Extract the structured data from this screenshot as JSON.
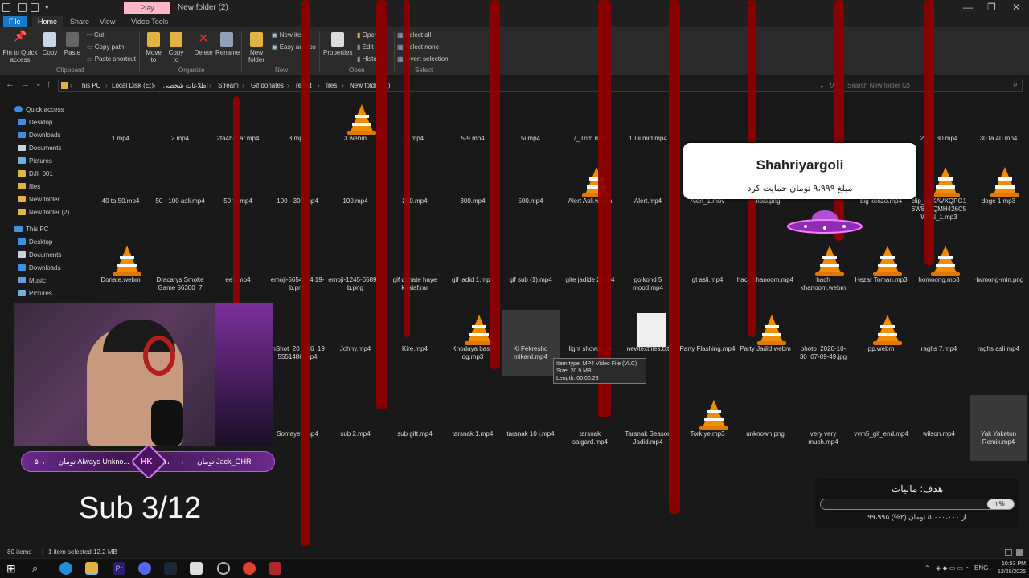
{
  "window": {
    "context_tab": "Play",
    "title": "New folder (2)",
    "minimize_glyph": "—",
    "maximize_glyph": "❐",
    "close_glyph": "✕"
  },
  "tabs": [
    "File",
    "Home",
    "Share",
    "View",
    "Video Tools"
  ],
  "ribbon": {
    "clipboard": {
      "pin_label": "Pin to Quick access",
      "copy_label": "Copy",
      "paste_label": "Paste",
      "cut_label": "Cut",
      "copy_path_label": "Copy path",
      "paste_shortcut_label": "Paste shortcut",
      "group_label": "Clipboard"
    },
    "organize": {
      "move_to_label": "Move to",
      "copy_to_label": "Copy to",
      "delete_label": "Delete",
      "rename_label": "Rename",
      "group_label": "Organize"
    },
    "new": {
      "new_folder_label": "New folder",
      "new_item_label": "New item",
      "easy_access_label": "Easy access",
      "group_label": "New"
    },
    "open": {
      "properties_label": "Properties",
      "open_label": "Open",
      "edit_label": "Edit",
      "history_label": "History",
      "group_label": "Open"
    },
    "select": {
      "select_all_label": "Select all",
      "select_none_label": "Select none",
      "invert_label": "Invert selection",
      "group_label": "Select"
    }
  },
  "address": {
    "back": "←",
    "forward": "→",
    "recent": "⌄",
    "up": "↑",
    "crumbs": [
      "This PC",
      "Local Disk (E:)",
      "اطلاعات شخصی",
      "Stream",
      "Gif donates",
      "reject",
      "files",
      "New folder (2)"
    ],
    "search_placeholder": "Search New folder (2)"
  },
  "sidebar": {
    "quick_access_label": "Quick access",
    "quick_items": [
      "Desktop",
      "Downloads",
      "Documents",
      "Pictures",
      "DJI_001",
      "files",
      "New folder",
      "New folder (2)"
    ],
    "this_pc_label": "This PC",
    "pc_items": [
      "Desktop",
      "Documents",
      "Downloads",
      "Music",
      "Pictures"
    ]
  },
  "files": [
    {
      "name": "1.mp4"
    },
    {
      "name": "2.mp4"
    },
    {
      "name": "2ta4hezar.mp4"
    },
    {
      "name": "3.mp4"
    },
    {
      "name": "3.webm"
    },
    {
      "name": "4.mp4"
    },
    {
      "name": "5-9.mp4"
    },
    {
      "name": "5i.mp4"
    },
    {
      "name": "7_Trim.mp4"
    },
    {
      "name": "10 ii mid.mp4"
    },
    {
      "name": "20 ta 30.mp4"
    },
    {
      "name": "30 ta 40.mp4"
    },
    {
      "name": "40 ta 50.mp4"
    },
    {
      "name": "50 - 100 asli.mp4"
    },
    {
      "name": "50 ta.mp4"
    },
    {
      "name": "100 - 300.mp4"
    },
    {
      "name": "100.mp4"
    },
    {
      "name": "200.mp4"
    },
    {
      "name": "300.mp4"
    },
    {
      "name": "500.mp4"
    },
    {
      "name": "Alert Asli.webm"
    },
    {
      "name": "Alert.mp4"
    },
    {
      "name": "Alert_1.mov"
    },
    {
      "name": "ambki.png"
    },
    {
      "name": "big kenzo.mp4"
    },
    {
      "name": "clip_01KAVXQPG16W8A2QMH426C5WYN_1.mp3"
    },
    {
      "name": "doge 1.mp3"
    },
    {
      "name": "Donate.webm"
    },
    {
      "name": "Dracarys Smoke Game 56300_7"
    },
    {
      "name": "eeh.mp4"
    },
    {
      "name": "emoji-5654254 19-b.png"
    },
    {
      "name": "emoji-1245-65891-b.png"
    },
    {
      "name": "gif donate haye khalaf.rar"
    },
    {
      "name": "gif jadid 1.mp4"
    },
    {
      "name": "gif sub (1).mp4"
    },
    {
      "name": "gife jadide 2.mp4"
    },
    {
      "name": "golkond 5 mood.mp4"
    },
    {
      "name": "gt asli.mp4"
    },
    {
      "name": "hach khanoom.mp4"
    },
    {
      "name": "hach khanoom.webm"
    },
    {
      "name": "Hezar Toman.mp3"
    },
    {
      "name": "homoong.mp3"
    },
    {
      "name": "Hwmong-min.png"
    },
    {
      "name": "InShot_20_706_195551486.mp4"
    },
    {
      "name": "Johny.mp4"
    },
    {
      "name": "Kire.mp4"
    },
    {
      "name": "Khodaya base dg.mp3"
    },
    {
      "name": "Ki Fekresho mikard.mp4"
    },
    {
      "name": "light show.mp4"
    },
    {
      "name": "newtextfiles.txt"
    },
    {
      "name": "Party Flashing.mp4"
    },
    {
      "name": "Party Jadid.webm"
    },
    {
      "name": "photo_2020-10-30_07-09-49.jpg"
    },
    {
      "name": "pp.webm"
    },
    {
      "name": "raghs 7.mp4"
    },
    {
      "name": "raghs asli.mp4"
    },
    {
      "name": "Somayeh.mp4"
    },
    {
      "name": "sub 2.mp4"
    },
    {
      "name": "sub gift.mp4"
    },
    {
      "name": "tarsnak 1.mp4"
    },
    {
      "name": "tarsnak 10 i.mp4"
    },
    {
      "name": "tarsnak salgard.mp4"
    },
    {
      "name": "Tarsnak Season Jadid.mp4"
    },
    {
      "name": "Torkiye.mp3"
    },
    {
      "name": "unknown.png"
    },
    {
      "name": "very very much.mp4"
    },
    {
      "name": "vvm5_gif_end.mp4"
    },
    {
      "name": "wilson.mp4"
    },
    {
      "name": "Yak Yaketon Remix.mp4"
    }
  ],
  "tooltip": {
    "type": "Item type: MP4 Video File (VLC)",
    "size": "Size: 20.9 MB",
    "length": "Length: 00:00:23"
  },
  "overlay": {
    "alert_name": "Shahriyargoli",
    "alert_message": "مبلغ ۹،۹۹۹ تومان حمایت کرد",
    "donor_left": "۵۰،۰۰۰ تومان Always Unkno...",
    "donor_badge": "HK",
    "donor_right": "۱،۰۰۰،۰۰۰ تومان Jack_GHR",
    "sub_counter": "Sub 3/12",
    "goal_title": "هدف: مالیات",
    "goal_percent_label": "۲%",
    "goal_amount": "۹۹،۹۹۵ از ۵،۰۰۰،۰۰۰ تومان (۲%)",
    "goal_progress": 0.02
  },
  "status": {
    "items": "80 items",
    "selected": "1 item selected 12.2 MB"
  },
  "taskbar": {
    "lang": "ENG",
    "time": "10:53 PM",
    "date": "12/28/2025"
  },
  "colors": {
    "accent": "#1979ca",
    "drip": "#8e0000",
    "vlc_orange": "#f28c00"
  }
}
